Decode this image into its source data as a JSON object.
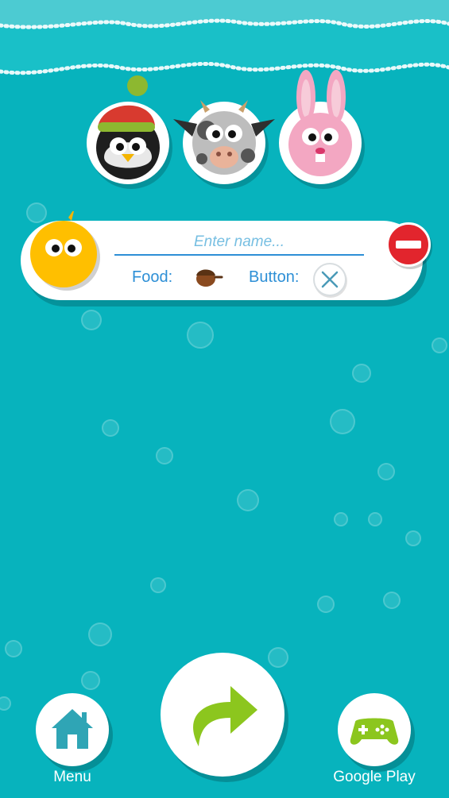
{
  "colors": {
    "background": "#07b3bd",
    "accent": "#2d8fd6",
    "remove": "#e2252d",
    "arrow": "#8cc61e"
  },
  "characters": [
    {
      "name": "penguin-avatar",
      "icon": "penguin-with-santa-hat"
    },
    {
      "name": "cow-avatar",
      "icon": "cow"
    },
    {
      "name": "bunny-avatar",
      "icon": "pink-bunny"
    }
  ],
  "player": {
    "avatar_icon": "yellow-chick",
    "name_value": "",
    "name_placeholder": "Enter name...",
    "food_label": "Food:",
    "food_icon": "acorn",
    "button_label": "Button:",
    "button_icon": "x-button"
  },
  "nav": {
    "menu_label": "Menu",
    "menu_icon": "house-icon",
    "next_icon": "curved-arrow-icon",
    "google_play_label": "Google Play",
    "google_play_icon": "gamepad-icon"
  }
}
